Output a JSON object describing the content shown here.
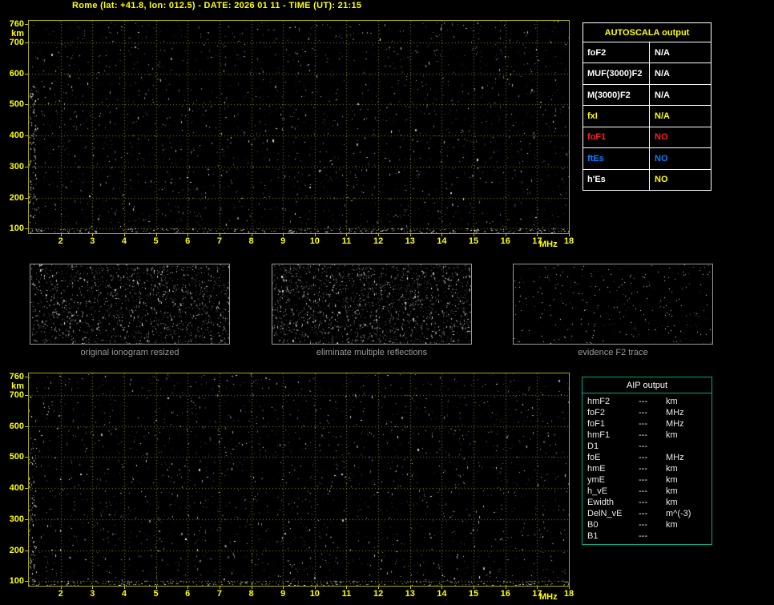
{
  "title": "Rome (lat: +41.8, lon: 012.5) - DATE: 2026 01 11 - TIME (UT): 21:15",
  "colors": {
    "background": "#000000",
    "title": "#ffff00",
    "axis": "#ffff00",
    "plot_border": "#a8a800",
    "grid": "#8f8f00",
    "autoscala_border": "#ffffff",
    "aip_border": "#00aa88",
    "caption": "#9a9a9a",
    "red": "#ff2020",
    "blue": "#0080ff",
    "white": "#ffffff",
    "yellow": "#ffff00"
  },
  "plots": {
    "y_unit": "km",
    "y_ticks": [
      760,
      700,
      600,
      500,
      400,
      300,
      200,
      100
    ],
    "x_ticks": [
      2,
      3,
      4,
      5,
      6,
      7,
      8,
      9,
      10,
      11,
      12,
      13,
      14,
      15,
      16,
      17,
      18
    ],
    "x_unit": "MHz",
    "x_range": [
      1,
      18
    ],
    "y_range": [
      85,
      770
    ]
  },
  "autoscala": {
    "header": "AUTOSCALA output",
    "rows": [
      {
        "label": "foF2",
        "value": "N/A",
        "color": "#ffffff"
      },
      {
        "label": "MUF(3000)F2",
        "value": "N/A",
        "color": "#ffffff"
      },
      {
        "label": "M(3000)F2",
        "value": "N/A",
        "color": "#ffffff"
      },
      {
        "label": "fxI",
        "value": "N/A",
        "color": "#ffff00"
      },
      {
        "label": "foF1",
        "value": "NO",
        "color": "#ff2020"
      },
      {
        "label": "ftEs",
        "value": "NO",
        "color": "#0080ff"
      },
      {
        "label": "h'Es",
        "value": "NO",
        "color": "#ffffff",
        "value_color": "#ffff00"
      }
    ]
  },
  "panels": [
    {
      "caption": "original ionogram resized"
    },
    {
      "caption": "eliminate multiple reflections"
    },
    {
      "caption": "evidence F2 trace"
    }
  ],
  "aip": {
    "header": "AIP output",
    "rows": [
      {
        "label": "hmF2",
        "value": "---",
        "unit": "km"
      },
      {
        "label": "foF2",
        "value": "---",
        "unit": "MHz"
      },
      {
        "label": "foF1",
        "value": "---",
        "unit": "MHz"
      },
      {
        "label": "hmF1",
        "value": "---",
        "unit": "km"
      },
      {
        "label": "D1",
        "value": "---",
        "unit": ""
      },
      {
        "label": "foE",
        "value": "---",
        "unit": "MHz"
      },
      {
        "label": "hmE",
        "value": "---",
        "unit": "km"
      },
      {
        "label": "ymE",
        "value": "---",
        "unit": "km"
      },
      {
        "label": "h_vE",
        "value": "---",
        "unit": "km"
      },
      {
        "label": "Ewidth",
        "value": "---",
        "unit": "km"
      },
      {
        "label": "DelN_vE",
        "value": "---",
        "unit": "m^(-3)"
      },
      {
        "label": "B0",
        "value": "---",
        "unit": "km"
      },
      {
        "label": "B1",
        "value": "---",
        "unit": ""
      }
    ]
  }
}
